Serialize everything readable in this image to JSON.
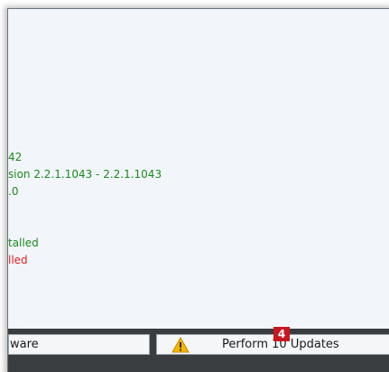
{
  "log_lines": [
    {
      "text": "42",
      "color": "green"
    },
    {
      "text": "sion 2.2.1.1043  -  2.2.1.1043",
      "color": "green"
    },
    {
      "text": ".0",
      "color": "green"
    },
    {
      "text": "talled",
      "color": "green"
    },
    {
      "text": "lled",
      "color": "red"
    }
  ],
  "footer": {
    "left_button_label": "ware",
    "updates_button_label": "Perform 10 Updates",
    "updates_badge": "4",
    "warning_icon": "warning-triangle-icon"
  },
  "colors": {
    "success": "#1b8a1b",
    "error": "#e02020",
    "badge": "#c8171e",
    "warning": "#f2b705"
  }
}
